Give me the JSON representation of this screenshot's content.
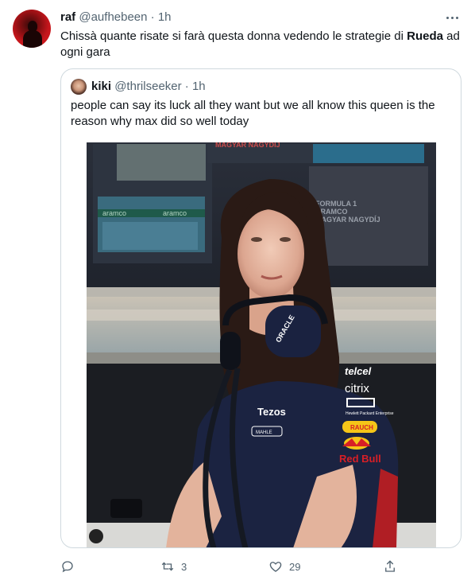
{
  "tweet": {
    "author_name": "raf",
    "author_handle": "@aufhebeen",
    "separator": "·",
    "time": "1h",
    "text_before": "Chissà quante risate si farà questa donna vedendo le strategie di ",
    "text_bold": "Rueda",
    "text_after": " ad ogni gara",
    "more_icon": "more-horizontal-icon"
  },
  "quote": {
    "author_name": "kiki",
    "author_handle": "@thrilseeker",
    "separator": "·",
    "time": "1h",
    "text": "people can say its luck all they want but we all know this queen is the reason why max did so well today"
  },
  "photo": {
    "screen_text_1": "MAGYAR NAGYDÍJ",
    "screen_text_2": "FORMULA 1",
    "screen_text_3": "ARAMCO",
    "screen_text_4": "MAGYAR NAGYDÍJ",
    "banner_1": "aramco",
    "banner_2": "aramco",
    "shirt_telcel": "telcel",
    "shirt_citrix": "citrix",
    "shirt_hpe": "Hewlett Packard Enterprise",
    "shirt_rauch": "RAUCH",
    "shirt_redbull": "Red Bull",
    "shirt_tezos": "Tezos",
    "shirt_mahle": "MAHLE",
    "headset_oracle": "ORACLE",
    "colors": {
      "shirt": "#1b2341",
      "redbull_red": "#d81f26",
      "redbull_yellow": "#f5c518"
    }
  },
  "actions": {
    "reply_count": "",
    "retweet_count": "3",
    "like_count": "29",
    "share_count": ""
  }
}
